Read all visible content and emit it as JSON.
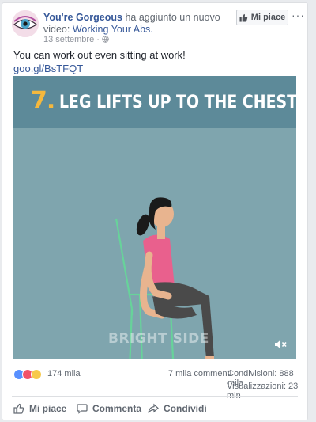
{
  "post": {
    "page_name": "You're Gorgeous",
    "action_text": "ha aggiunto un nuovo video:",
    "video_title": "Working Your Abs.",
    "date": "13 settembre",
    "date_sep": "·",
    "like_page_label": "Mi piace",
    "more_label": "···",
    "text": "You can work out even sitting at work!",
    "link": "goo.gl/BsTFQT"
  },
  "video": {
    "number": "7.",
    "title": "LEG LIFTS UP TO THE CHEST",
    "watermark": "BRIGHT SIDE",
    "mute_icon": "volume-muted-icon"
  },
  "stats": {
    "reactions": "174 mila",
    "comments": "7 mila commenti",
    "shares": "Condivisioni: 888 mila",
    "views": "Visualizzazioni: 23 mln"
  },
  "actions": {
    "like": "Mi piace",
    "comment": "Commenta",
    "share": "Condividi"
  },
  "colors": {
    "link": "#365899",
    "banner": "#5d8a99",
    "video_bg": "#7fa5ae",
    "number": "#f5b83d"
  }
}
